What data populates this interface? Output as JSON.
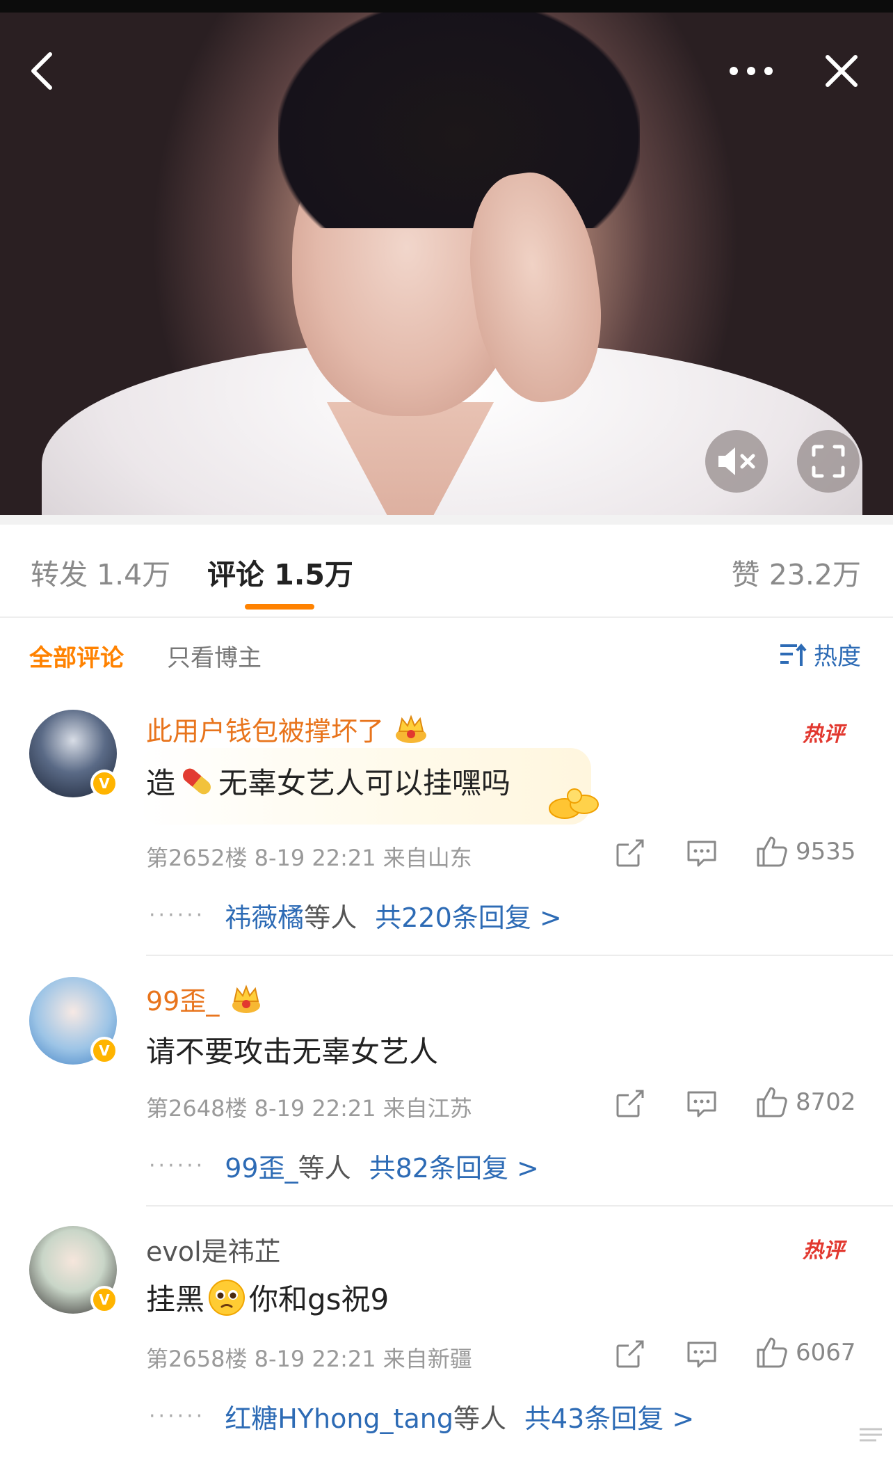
{
  "video": {
    "back_icon": "chevron-left-icon",
    "more_icon": "more-dots-icon",
    "close_icon": "close-icon",
    "mute_icon": "speaker-muted-icon",
    "fullscreen_icon": "fullscreen-icon"
  },
  "tabs": {
    "repost": "转发 1.4万",
    "comment": "评论 1.5万",
    "like": "赞 23.2万",
    "active": "comment",
    "accent": "#ff8200"
  },
  "filters": {
    "all": "全部评论",
    "owner_only": "只看博主",
    "sort": "热度",
    "sort_icon": "sort-lines-icon"
  },
  "comments": [
    {
      "username": "此用户钱包被撑坏了",
      "hot": "热评",
      "text_before": "造",
      "emoji": "pill-emoji",
      "text_after": "无辜女艺人可以挂嘿吗",
      "meta": "第2652楼  8-19 22:21  来自山东",
      "likes": "9535",
      "reply_names": "祎薇橘",
      "reply_mid": "等人",
      "reply_total": "共220条回复 >"
    },
    {
      "username": "99歪_",
      "hot": "",
      "text_before": "请不要攻击无辜女艺人",
      "emoji": "",
      "text_after": "",
      "meta": "第2648楼  8-19 22:21  来自江苏",
      "likes": "8702",
      "reply_names": "99歪_",
      "reply_mid": "等人",
      "reply_total": "共82条回复 >"
    },
    {
      "username": "evol是祎芷",
      "hot": "热评",
      "text_before": "挂黑",
      "emoji": "pleading-face-emoji",
      "text_after": "你和gs祝9",
      "meta": "第2658楼  8-19 22:21  来自新疆",
      "likes": "6067",
      "reply_names": "红糖HYhong_tang",
      "reply_mid": "等人",
      "reply_total": "共43条回复 >"
    }
  ],
  "colors": {
    "username_vip": "#e8741c",
    "link_blue": "#2d6bb5",
    "hot_red": "#e2382f",
    "verified_gold": "#ffb400"
  }
}
